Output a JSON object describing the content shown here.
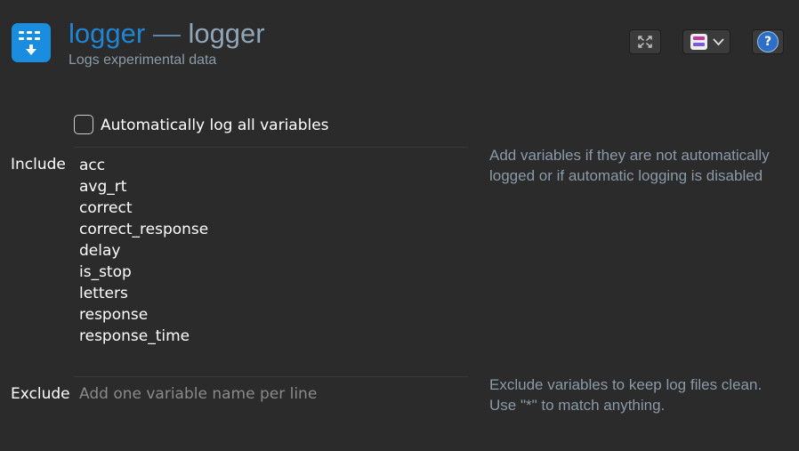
{
  "header": {
    "item_name": "logger",
    "separator": "—",
    "item_type": "logger",
    "description": "Logs experimental data"
  },
  "toolbar": {
    "buttons": [
      {
        "name": "fullscreen",
        "icon": "expand-icon"
      },
      {
        "name": "view-toggle",
        "icon": "view-toggle-icon"
      },
      {
        "name": "help",
        "icon": "help-icon",
        "glyph": "?"
      }
    ]
  },
  "auto_log": {
    "label": "Automatically log all variables",
    "checked": false
  },
  "include": {
    "label": "Include",
    "variables": [
      "acc",
      "avg_rt",
      "correct",
      "correct_response",
      "delay",
      "is_stop",
      "letters",
      "response",
      "response_time"
    ],
    "hint": "Add variables if they are not automatically logged or if automatic logging is disabled"
  },
  "exclude": {
    "label": "Exclude",
    "value": "",
    "placeholder": "Add one variable name per line",
    "hint": "Exclude variables to keep log files clean. Use \"*\" to match anything."
  },
  "colors": {
    "background": "#2b2b2b",
    "accent": "#1f86d6",
    "hint_text": "#8a9aa8",
    "icon_bg": "#1a8de0"
  }
}
